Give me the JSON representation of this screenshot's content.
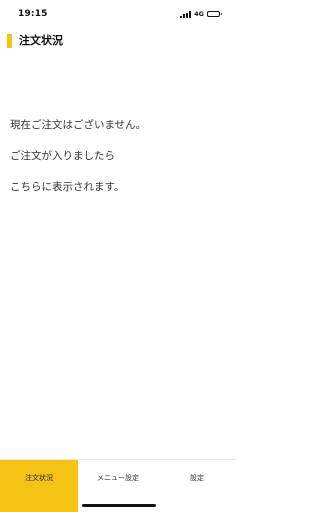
{
  "status_bar": {
    "time": "19:15",
    "network": "4G",
    "icons": [
      "signal-icon",
      "battery-icon"
    ]
  },
  "header": {
    "title": "注文状況"
  },
  "message": {
    "lines": [
      "現在ご注文はございません。",
      "ご注文が入りましたら",
      "こちらに表示されます。"
    ]
  },
  "tabs": [
    {
      "label": "注文状況",
      "active": true
    },
    {
      "label": "メニュー設定",
      "active": false
    },
    {
      "label": "設定",
      "active": false
    }
  ],
  "colors": {
    "accent": "#f5c316",
    "background": "#ffffff",
    "text": "#333333"
  }
}
